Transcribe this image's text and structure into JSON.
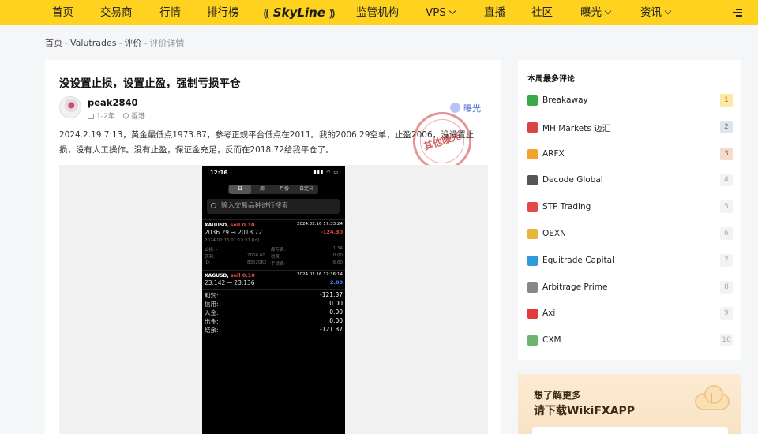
{
  "nav": {
    "items": [
      {
        "label": "首页"
      },
      {
        "label": "交易商"
      },
      {
        "label": "行情"
      },
      {
        "label": "排行榜"
      },
      {
        "label": "监管机构"
      },
      {
        "label": "VPS"
      },
      {
        "label": "直播"
      },
      {
        "label": "社区"
      },
      {
        "label": "曝光"
      },
      {
        "label": "资讯"
      }
    ],
    "logo_text": "SkyLine"
  },
  "breadcrumb": {
    "items": [
      "首页",
      "Valutrades",
      "评价"
    ],
    "current": "评价详情",
    "separator": "-"
  },
  "post": {
    "title": "没设置止损，设置止盈，强制亏损平仓",
    "author": "peak2840",
    "duration": "1-2年",
    "location": "香港",
    "badge": "曝光",
    "stamp": "其他曝光",
    "content": "2024.2.19 7:13，黄金最低点1973.87，参考正规平台低点在2011。我的2006.29空单，止盈2006，没设置止损，没有人工操作。没有止盈，保证金充足，反而在2018.72给我平仓了。"
  },
  "phone": {
    "time": "12:16",
    "tabs": [
      "日",
      "周",
      "月份",
      "自定义"
    ],
    "search_placeholder": "输入交易品种进行搜索",
    "trade1": {
      "symbol": "XAUUSD,",
      "side": "sell 0.10",
      "date": "2024.02.16 17:33:24",
      "price": "2036.29 → 2018.72",
      "pnl": "-124.30",
      "open_time": "2024.02.16 01:13:37 [id]",
      "sl_label": "止损:",
      "sl_value": "-",
      "swap_label": "库存费:",
      "swap_value": "1.34",
      "tp_label": "获利:",
      "tp_value": "2006.60",
      "tax_label": "税费:",
      "tax_value": "0.00",
      "id_label": "ID:",
      "id_value": "8352062",
      "fee_label": "手续费:",
      "fee_value": "-6.60"
    },
    "trade2": {
      "symbol": "XAGUSD,",
      "side": "sell 0.10",
      "date": "2024.02.16 17:36:14",
      "price": "23.142 → 23.136",
      "pnl": "2.00"
    },
    "summary": [
      {
        "label": "利润:",
        "value": "-121.37"
      },
      {
        "label": "信用:",
        "value": "0.00"
      },
      {
        "label": "入金:",
        "value": "0.00"
      },
      {
        "label": "出金:",
        "value": "0.00"
      },
      {
        "label": "结余:",
        "value": "-121.37"
      }
    ]
  },
  "sidebar": {
    "title": "本周最多评论",
    "items": [
      {
        "name": "Breakaway",
        "rank": "1",
        "color": "#3aa845"
      },
      {
        "name": "MH Markets 迈汇",
        "rank": "2",
        "color": "#d94545"
      },
      {
        "name": "ARFX",
        "rank": "3",
        "color": "#f2a32a"
      },
      {
        "name": "Decode Global",
        "rank": "4",
        "color": "#555555"
      },
      {
        "name": "STP Trading",
        "rank": "5",
        "color": "#e24a4a"
      },
      {
        "name": "OEXN",
        "rank": "6",
        "color": "#e7b43c"
      },
      {
        "name": "Equitrade Capital",
        "rank": "7",
        "color": "#2d9bd8"
      },
      {
        "name": "Arbitrage Prime",
        "rank": "8",
        "color": "#888888"
      },
      {
        "name": "Axi",
        "rank": "9",
        "color": "#e23b3b"
      },
      {
        "name": "CXM",
        "rank": "10",
        "color": "#6cb36c"
      }
    ]
  },
  "app_promo": {
    "line1": "想了解更多",
    "line2": "请下载WikiFXAPP"
  }
}
